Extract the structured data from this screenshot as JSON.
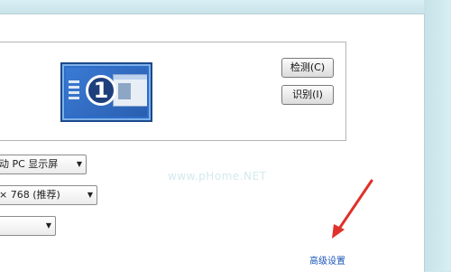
{
  "monitor_preview": {
    "display_number": "1"
  },
  "buttons": {
    "detect_label": "检测(C)",
    "identify_label": "识别(I)"
  },
  "display_select": {
    "value": "动 PC 显示屏"
  },
  "resolution_select": {
    "value": "× 768 (推荐)"
  },
  "orientation_select": {
    "value": ""
  },
  "advanced_link": {
    "label": "高级设置"
  },
  "watermark": {
    "text": "www.pHome.NET"
  },
  "bottom_strip": {
    "text": ""
  },
  "colors": {
    "link": "#1a54b8",
    "annotation_arrow": "#e0312b",
    "monitor": "#2d6cc9"
  }
}
